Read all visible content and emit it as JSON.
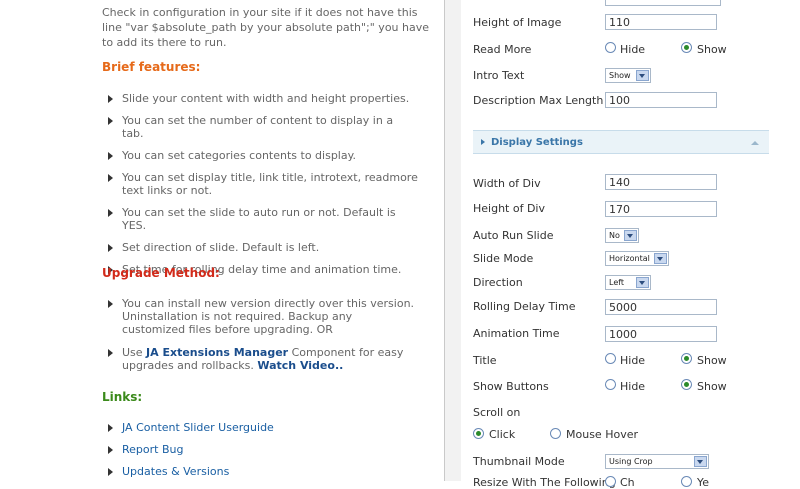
{
  "left": {
    "intro": "Check in configuration in your site if it does not have this line \"var $absolute_path by your absolute path\";\" you have to add its there to run.",
    "brief_heading": "Brief features:",
    "brief_items": [
      "Slide your content with width and height properties.",
      "You can set the number of content to display in a tab.",
      "You can set categories contents to display.",
      "You can set display title, link title, introtext, readmore text links or not.",
      "You can set the slide to auto run or not. Default is YES.",
      "Set direction of slide. Default is left.",
      "Set time for rolling delay time and animation time."
    ],
    "upgrade_heading": "Upgrade Method:",
    "upgrade_item1": "You can install new version directly over this version. Uninstallation is not required. Backup any customized files before upgrading. OR",
    "upgrade_item2_pre": "Use ",
    "upgrade_item2_link": "JA Extensions Manager",
    "upgrade_item2_mid": " Component for easy upgrades and rollbacks. ",
    "upgrade_item2_video": "Watch Video..",
    "links_heading": "Links:",
    "links": [
      "JA Content Slider Userguide",
      "Report Bug",
      "Updates & Versions"
    ]
  },
  "right": {
    "height_of_image_label": "Height of Image",
    "height_of_image_value": "110",
    "read_more_label": "Read More",
    "hide": "Hide",
    "show": "Show",
    "intro_text_label": "Intro Text",
    "intro_text_value": "Show",
    "desc_max_label": "Description Max Length",
    "desc_max_value": "100",
    "display_settings": "Display Settings",
    "width_of_div_label": "Width of Div",
    "width_of_div_value": "140",
    "height_of_div_label": "Height of Div",
    "height_of_div_value": "170",
    "auto_run_label": "Auto Run Slide",
    "auto_run_value": "No",
    "slide_mode_label": "Slide Mode",
    "slide_mode_value": "Horizontal",
    "direction_label": "Direction",
    "direction_value": "Left",
    "rolling_label": "Rolling Delay Time",
    "rolling_value": "5000",
    "animation_label": "Animation Time",
    "animation_value": "1000",
    "title_label": "Title",
    "show_buttons_label": "Show Buttons",
    "scroll_on_label": "Scroll on",
    "click": "Click",
    "mouse_hover": "Mouse Hover",
    "thumbnail_label": "Thumbnail Mode",
    "thumbnail_value": "Using Crop",
    "cut_label": "Resize With The Following",
    "cut_opt1": "Ch",
    "cut_opt2": "Ye"
  },
  "colors": {
    "orange_heading": "#e66a1a",
    "red_heading": "#d22a1a",
    "green_heading": "#3b8a1b",
    "link_blue": "#1a5fa3",
    "panel_blue": "#3a76a8"
  }
}
